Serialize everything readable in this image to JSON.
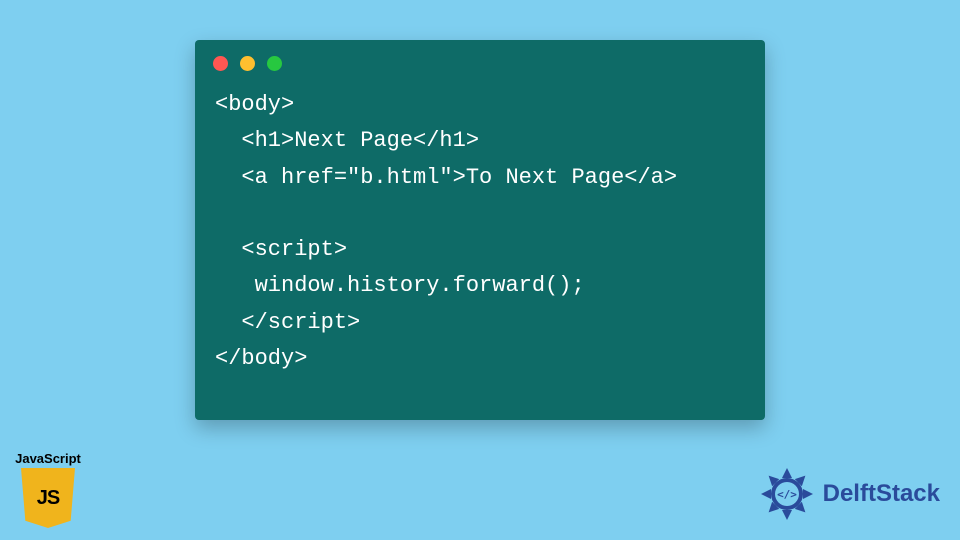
{
  "code": {
    "lines": [
      "<body>",
      "  <h1>Next Page</h1>",
      "  <a href=\"b.html\">To Next Page</a>",
      "",
      "  <script>",
      "   window.history.forward();",
      "  </script>",
      "</body>"
    ]
  },
  "js_badge": {
    "label": "JavaScript",
    "shield_text": "JS"
  },
  "brand": {
    "name": "DelftStack"
  },
  "colors": {
    "background": "#7ecff0",
    "code_bg": "#0e6b67",
    "code_fg": "#ffffff",
    "js_yellow": "#f0b41c",
    "brand_blue": "#2a4b9b"
  }
}
